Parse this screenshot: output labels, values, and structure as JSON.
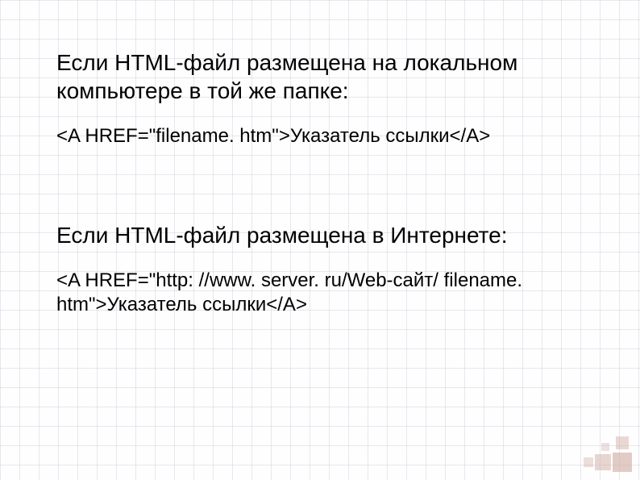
{
  "section1": {
    "heading": "Если HTML-файл размещена на локальном компьютере в той же папке:",
    "code": "<A HREF=\"filename. htm\">Указатель ссылки</A>"
  },
  "section2": {
    "heading": "Если HTML-файл размещена в Интернете:",
    "code": "<A HREF=\"http: //www. server. ru/Web-сайт/ filename. htm\">Указатель ссылки</A>"
  }
}
